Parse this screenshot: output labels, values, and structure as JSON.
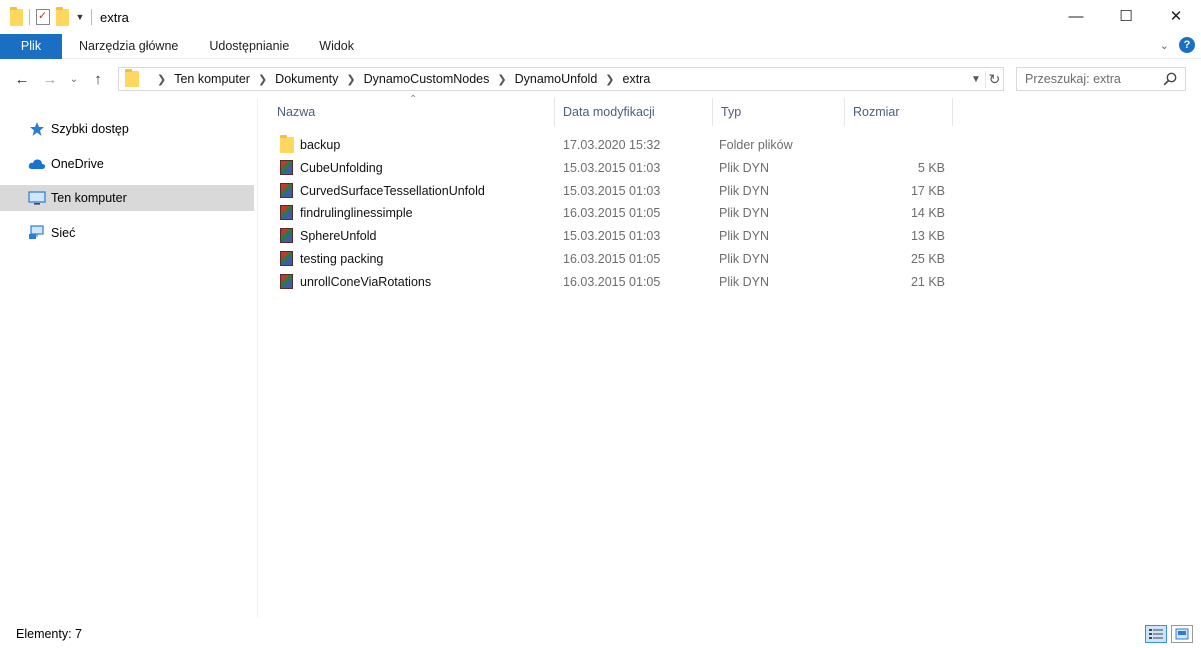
{
  "window": {
    "title": "extra"
  },
  "ribbon": {
    "tabs": [
      "Plik",
      "Narzędzia główne",
      "Udostępnianie",
      "Widok"
    ]
  },
  "address": {
    "crumbs": [
      "Ten komputer",
      "Dokumenty",
      "DynamoCustomNodes",
      "DynamoUnfold",
      "extra"
    ]
  },
  "search": {
    "placeholder": "Przeszukaj: extra"
  },
  "sidebar": {
    "items": [
      {
        "label": "Szybki dostęp",
        "icon": "star-icon"
      },
      {
        "label": "OneDrive",
        "icon": "cloud-icon"
      },
      {
        "label": "Ten komputer",
        "icon": "computer-icon"
      },
      {
        "label": "Sieć",
        "icon": "network-icon"
      }
    ],
    "active": "Ten komputer"
  },
  "columns": {
    "name": "Nazwa",
    "date": "Data modyfikacji",
    "type": "Typ",
    "size": "Rozmiar"
  },
  "files": [
    {
      "name": "backup",
      "date": "17.03.2020 15:32",
      "type": "Folder plików",
      "size": "",
      "icon": "folder-icon"
    },
    {
      "name": "CubeUnfolding",
      "date": "15.03.2015 01:03",
      "type": "Plik DYN",
      "size": "5 KB",
      "icon": "dyn-file-icon"
    },
    {
      "name": "CurvedSurfaceTessellationUnfold",
      "date": "15.03.2015 01:03",
      "type": "Plik DYN",
      "size": "17 KB",
      "icon": "dyn-file-icon"
    },
    {
      "name": "findrulinglinessimple",
      "date": "16.03.2015 01:05",
      "type": "Plik DYN",
      "size": "14 KB",
      "icon": "dyn-file-icon"
    },
    {
      "name": "SphereUnfold",
      "date": "15.03.2015 01:03",
      "type": "Plik DYN",
      "size": "13 KB",
      "icon": "dyn-file-icon"
    },
    {
      "name": "testing packing",
      "date": "16.03.2015 01:05",
      "type": "Plik DYN",
      "size": "25 KB",
      "icon": "dyn-file-icon"
    },
    {
      "name": "unrollConeViaRotations",
      "date": "16.03.2015 01:05",
      "type": "Plik DYN",
      "size": "21 KB",
      "icon": "dyn-file-icon"
    }
  ],
  "status": {
    "text": "Elementy: 7"
  },
  "colors": {
    "accent": "#1a6fc2",
    "folder": "#ffd75e",
    "selection": "#d9d9d9"
  }
}
